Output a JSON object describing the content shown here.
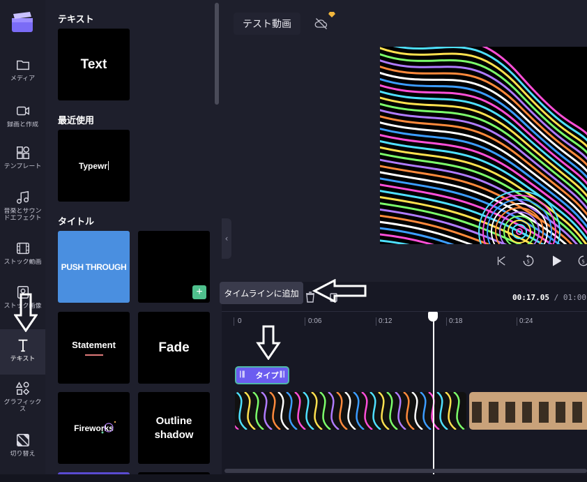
{
  "sidebar": {
    "items": [
      {
        "label": "メディア",
        "icon": "folder-icon"
      },
      {
        "label": "録画と作成",
        "icon": "camera-icon"
      },
      {
        "label": "テンプレート",
        "icon": "template-icon"
      },
      {
        "label": "音楽とサウンドエフェクト",
        "icon": "music-icon"
      },
      {
        "label": "ストック動画",
        "icon": "film-icon"
      },
      {
        "label": "ストック画像",
        "icon": "image-icon"
      },
      {
        "label": "テキスト",
        "icon": "text-t-icon"
      },
      {
        "label": "グラフィックス",
        "icon": "shapes-icon"
      },
      {
        "label": "切り替え",
        "icon": "transition-icon"
      }
    ]
  },
  "library": {
    "section_text": "テキスト",
    "card_text": "Text",
    "section_recent": "最近使用",
    "card_recent": "Typewr",
    "section_title": "タイトル",
    "cards": {
      "push_through": "PUSH THROUGH",
      "statement": "Statement",
      "fade": "Fade",
      "fireworks": "Fireworks",
      "outline_shadow": "Outline shadow"
    },
    "add_button": "+"
  },
  "header": {
    "project_name": "テスト動画"
  },
  "timeline": {
    "tooltip": "タイムラインに追加",
    "current_time": "00:17.05",
    "total_time": " / 01:00",
    "ticks": [
      "0",
      "0:06",
      "0:12",
      "0:18",
      "0:24"
    ],
    "text_clip_label": "タイプ"
  },
  "colors": {
    "accent": "#6b5cf0",
    "push_through_bg": "#4a8fe0",
    "add_button": "#4fc08d"
  }
}
